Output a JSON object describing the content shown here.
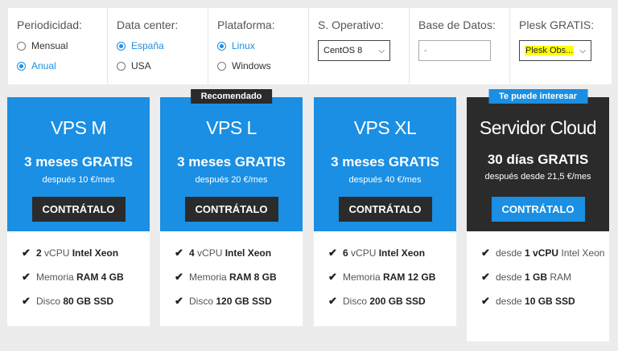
{
  "filters": {
    "periodicidad": {
      "title": "Periodicidad:",
      "options": [
        {
          "label": "Mensual",
          "checked": false
        },
        {
          "label": "Anual",
          "checked": true
        }
      ]
    },
    "datacenter": {
      "title": "Data center:",
      "options": [
        {
          "label": "España",
          "checked": true
        },
        {
          "label": "USA",
          "checked": false
        }
      ]
    },
    "plataforma": {
      "title": "Plataforma:",
      "options": [
        {
          "label": "Linux",
          "checked": true
        },
        {
          "label": "Windows",
          "checked": false
        }
      ]
    },
    "so": {
      "title": "S. Operativo:",
      "value": "CentOS 8"
    },
    "db": {
      "title": "Base de Datos:",
      "value": "-"
    },
    "plesk": {
      "title": "Plesk GRATIS:",
      "value": "Plesk Obs..."
    }
  },
  "plans": [
    {
      "name": "VPS M",
      "promo": "3 meses GRATIS",
      "after": "después 10 €/mes",
      "cta": "CONTRÁTALO",
      "features": [
        {
          "pre": "2",
          "mid": " vCPU ",
          "bold": "Intel Xeon"
        },
        {
          "pre": "",
          "mid": "Memoria ",
          "bold": "RAM 4 GB"
        },
        {
          "pre": "",
          "mid": "Disco ",
          "bold": "80 GB SSD"
        }
      ]
    },
    {
      "name": "VPS L",
      "badge": "Recomendado",
      "promo": "3 meses GRATIS",
      "after": "después 20 €/mes",
      "cta": "CONTRÁTALO",
      "features": [
        {
          "pre": "4",
          "mid": " vCPU ",
          "bold": "Intel Xeon"
        },
        {
          "pre": "",
          "mid": "Memoria ",
          "bold": "RAM 8 GB"
        },
        {
          "pre": "",
          "mid": "Disco ",
          "bold": "120 GB SSD"
        }
      ]
    },
    {
      "name": "VPS XL",
      "promo": "3 meses GRATIS",
      "after": "después 40 €/mes",
      "cta": "CONTRÁTALO",
      "features": [
        {
          "pre": "6",
          "mid": " vCPU ",
          "bold": "Intel Xeon"
        },
        {
          "pre": "",
          "mid": "Memoria ",
          "bold": "RAM 12 GB"
        },
        {
          "pre": "",
          "mid": "Disco ",
          "bold": "200 GB SSD"
        }
      ]
    },
    {
      "name": "Servidor Cloud",
      "badge": "Te puede interesar",
      "promo": "30 días GRATIS",
      "after": "después desde 21,5 €/mes",
      "cta": "CONTRÁTALO",
      "features": [
        {
          "text": "desde ",
          "bold": "1 vCPU",
          "tail": " Intel Xeon"
        },
        {
          "text": "desde ",
          "bold": "1 GB",
          "tail": " RAM"
        },
        {
          "text": "desde ",
          "bold": "10 GB SSD",
          "tail": ""
        }
      ]
    }
  ],
  "colors": {
    "accent": "#1a8fe3",
    "dark": "#2b2b2b",
    "highlight": "#ffff00"
  }
}
